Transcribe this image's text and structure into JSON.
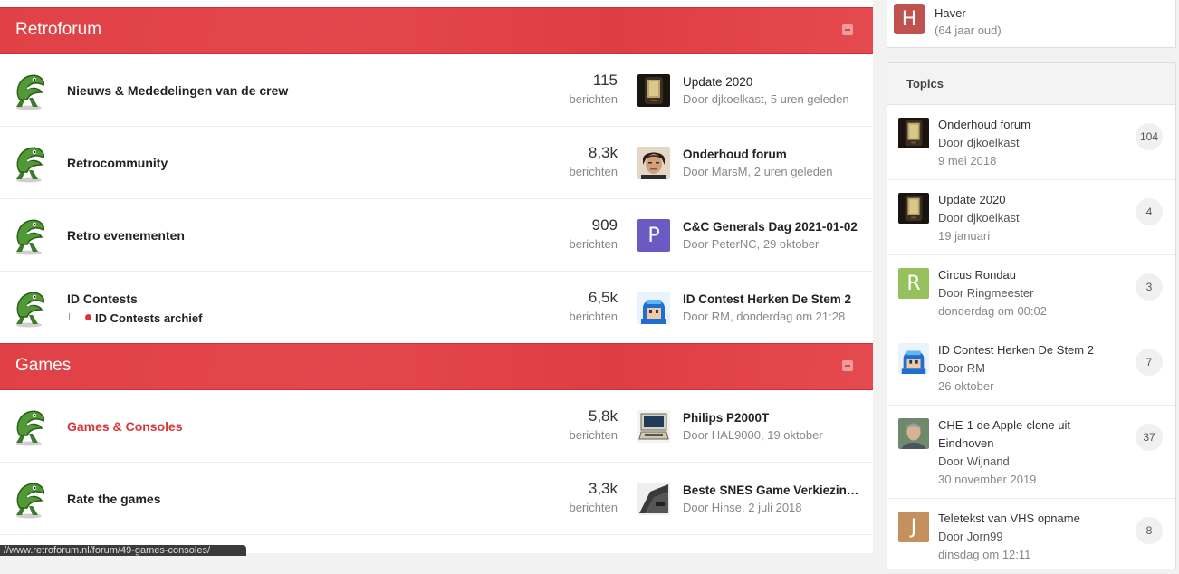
{
  "categories": [
    {
      "title": "Retroforum",
      "forums": [
        {
          "name": "Nieuws & Mededelingen van de crew",
          "count": "115",
          "count_label": "berichten",
          "last_title": "Update 2020",
          "last_meta": "Door djkoelkast, 5 uren geleden"
        },
        {
          "name": "Retrocommunity",
          "count": "8,3k",
          "count_label": "berichten",
          "last_title": "Onderhoud forum",
          "last_meta": "Door MarsM, 2 uren geleden"
        },
        {
          "name": "Retro evenementen",
          "count": "909",
          "count_label": "berichten",
          "last_title": "C&C Generals Dag 2021-01-02",
          "last_meta": "Door PeterNC, 29 oktober",
          "last_avatar_letter": "P"
        },
        {
          "name": "ID Contests",
          "subforum": "ID Contests archief",
          "count": "6,5k",
          "count_label": "berichten",
          "last_title": "ID Contest Herken De Stem 2",
          "last_meta": "Door RM, donderdag om 21:28"
        }
      ]
    },
    {
      "title": "Games",
      "forums": [
        {
          "name": "Games & Consoles",
          "count": "5,8k",
          "count_label": "berichten",
          "last_title": "Philips P2000T",
          "last_meta": "Door HAL9000, 19 oktober"
        },
        {
          "name": "Rate the games",
          "count": "3,3k",
          "count_label": "berichten",
          "last_title": "Beste SNES Game Verkiezing -...",
          "last_meta": "Door Hinse, 2 juli 2018"
        }
      ]
    }
  ],
  "sidebar": {
    "user": {
      "letter": "H",
      "name": "Haver",
      "age": "(64 jaar oud)"
    },
    "topics_title": "Topics",
    "topics": [
      {
        "title": "Onderhoud forum",
        "by": "Door djkoelkast",
        "date": "9 mei 2018",
        "count": "104"
      },
      {
        "title": "Update 2020",
        "by": "Door djkoelkast",
        "date": "19 januari",
        "count": "4"
      },
      {
        "title": "Circus Rondau",
        "by": "Door Ringmeester",
        "date": "donderdag om 00:02",
        "count": "3",
        "letter": "R"
      },
      {
        "title": "ID Contest Herken De Stem 2",
        "by": "Door RM",
        "date": "26 oktober",
        "count": "7"
      },
      {
        "title": "CHE-1 de Apple-clone uit Eindhoven",
        "by": "Door Wijnand",
        "date": "30 november 2019",
        "count": "37"
      },
      {
        "title": "Teletekst van VHS opname",
        "by": "Door Jorn99",
        "date": "dinsdag om 12:11",
        "count": "8",
        "letter": "J"
      }
    ]
  },
  "statusbar": "//www.retroforum.nl/forum/49-games-consoles/",
  "colors": {
    "accent": "#e04146",
    "letter_H": "#c0514f",
    "letter_P": "#6a5bc4",
    "letter_R": "#96c05b",
    "letter_J": "#c4905e"
  }
}
